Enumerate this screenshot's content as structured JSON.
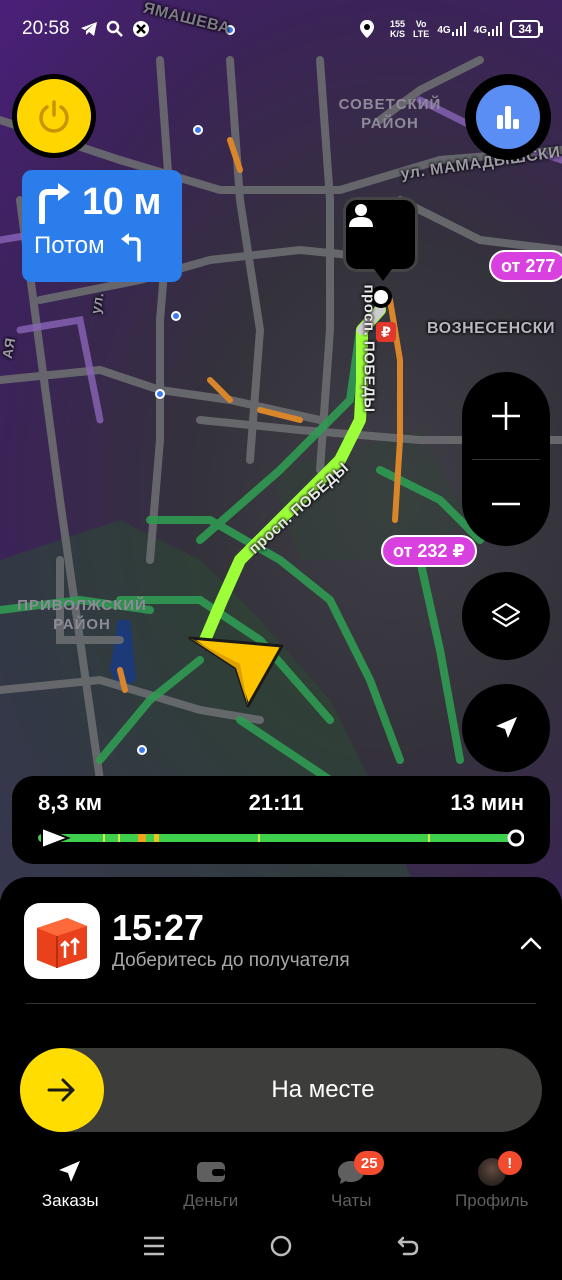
{
  "status_bar": {
    "time": "20:58",
    "speed_value": "155",
    "speed_unit": "K/S",
    "net_volte": "Vo",
    "net_lte": "LTE",
    "net_4g_1": "4G",
    "net_4g_2": "4G",
    "battery": "34"
  },
  "map": {
    "districts": [
      "СОВЕТСКИЙ\nРАЙОН",
      "ПРИВОЛЖСКИЙ\nРАЙОН"
    ],
    "district_sovetsky": "СОВЕТСКИЙ РАЙОН",
    "district_privolzhsky": "ПРИВОЛЖСКИЙ РАЙОН",
    "street_yamasheva": "ЯМАШЕВА",
    "street_mamadyshsky": "ул. МАМАДЫШСКИ",
    "street_voznesensky": "ВОЗНЕСЕНСКИ",
    "street_pobedy_1": "просп. ПОБЕДЫ",
    "street_pobedy_2": "просп. ПОБЕДЫ",
    "street_ul": "ул.",
    "street_aya": "АЯ",
    "price_tag_1": "от 277",
    "price_tag_2": "от 232 ₽",
    "parking_symbol": "₽"
  },
  "maneuver": {
    "distance": "10 м",
    "then_label": "Потом"
  },
  "route": {
    "distance": "8,3 км",
    "arrival": "21:11",
    "duration": "13 мин",
    "progress": 0.0
  },
  "order": {
    "eta": "15:27",
    "subtitle": "Доберитесь до получателя",
    "slider_label": "На месте"
  },
  "bottom_nav": {
    "orders": "Заказы",
    "money": "Деньги",
    "chats": "Чаты",
    "chats_badge": "25",
    "profile": "Профиль",
    "profile_badge": "!"
  },
  "colors": {
    "accent_yellow": "#ffdd00",
    "route_green": "#39d74a",
    "maneuver_blue": "#2a7dea",
    "price_tag": "#d940e0",
    "badge_red": "#f24b2e"
  }
}
